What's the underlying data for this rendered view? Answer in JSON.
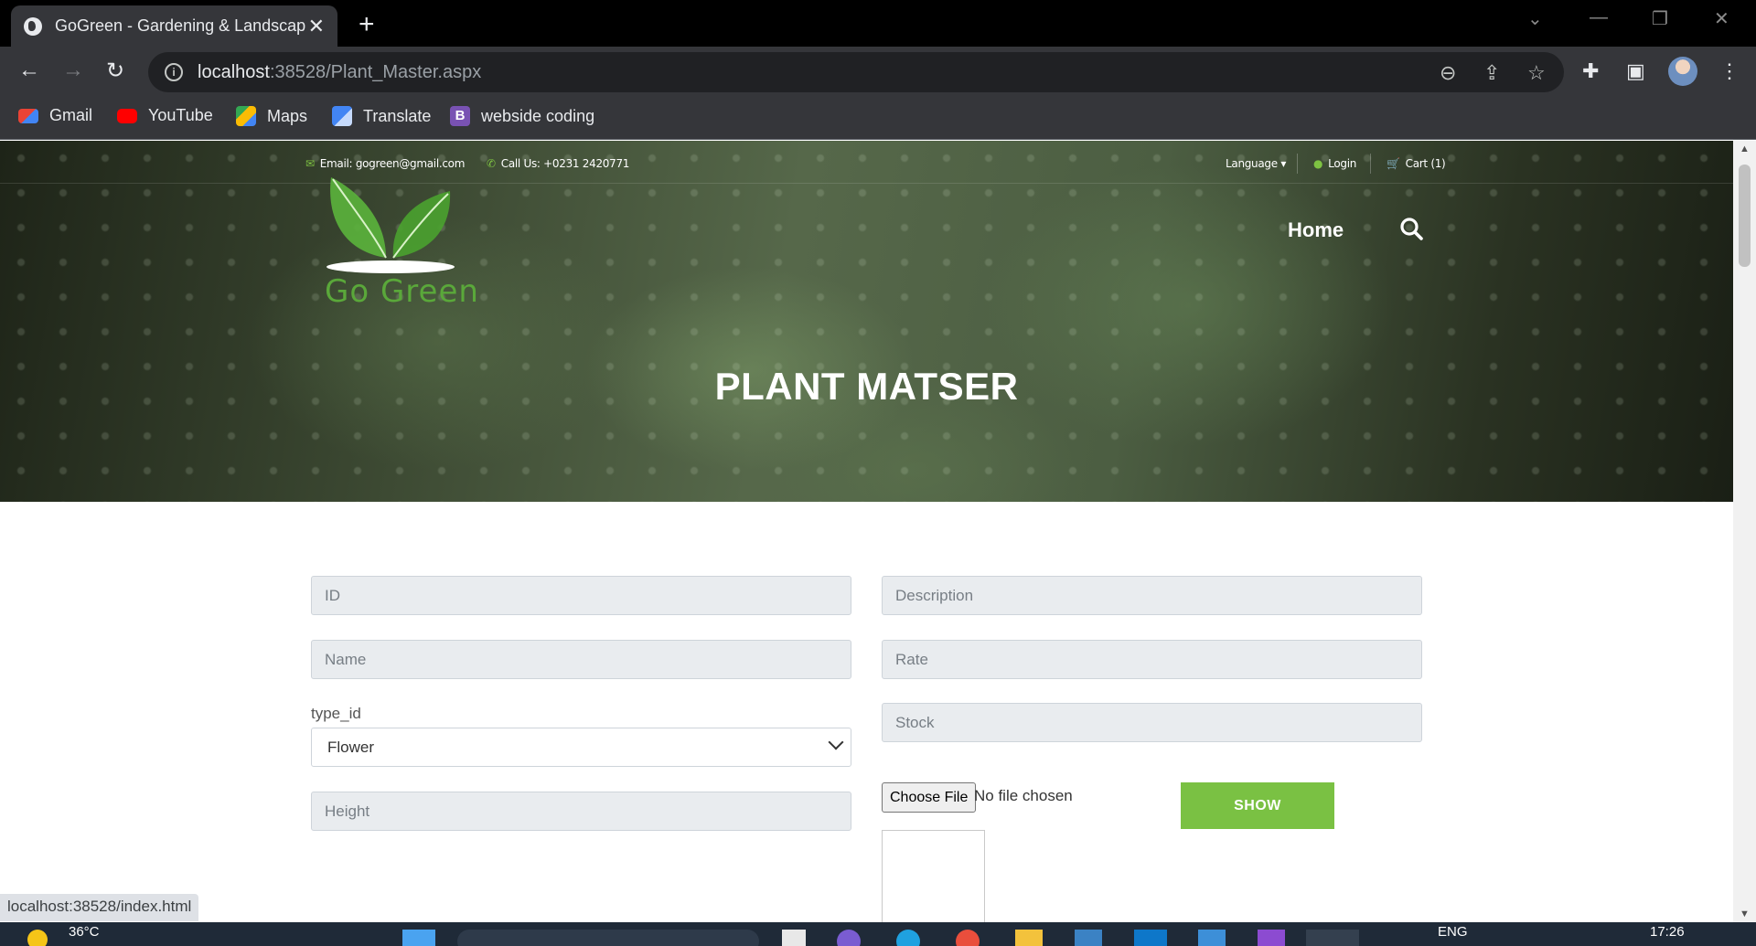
{
  "browser": {
    "tab_title": "GoGreen - Gardening & Landscap",
    "url_host": "localhost",
    "url_path": ":38528/Plant_Master.aspx",
    "status_url": "localhost:38528/index.html"
  },
  "bookmarks": [
    {
      "label": "Gmail",
      "icon": "gmail-icon"
    },
    {
      "label": "YouTube",
      "icon": "youtube-icon"
    },
    {
      "label": "Maps",
      "icon": "maps-icon"
    },
    {
      "label": "Translate",
      "icon": "translate-icon"
    },
    {
      "label": "webside coding",
      "icon": "bootstrap-icon"
    }
  ],
  "site": {
    "email": "Email: gogreen@gmail.com",
    "phone": "Call Us: +0231 2420771",
    "language": "Language",
    "login": "Login",
    "cart": "Cart (1)",
    "logo_text": "Go Green",
    "nav_home": "Home",
    "page_title": "PLANT MATSER",
    "accent_color": "#7ac143"
  },
  "form": {
    "id_placeholder": "ID",
    "name_placeholder": "Name",
    "type_label": "type_id",
    "type_selected": "Flower",
    "height_placeholder": "Height",
    "description_placeholder": "Description",
    "rate_placeholder": "Rate",
    "stock_placeholder": "Stock",
    "file_button": "Choose File",
    "file_status": "No file chosen",
    "show_button": "SHOW"
  },
  "taskbar": {
    "weather": "36°C",
    "language": "ENG",
    "time": "17:26"
  }
}
